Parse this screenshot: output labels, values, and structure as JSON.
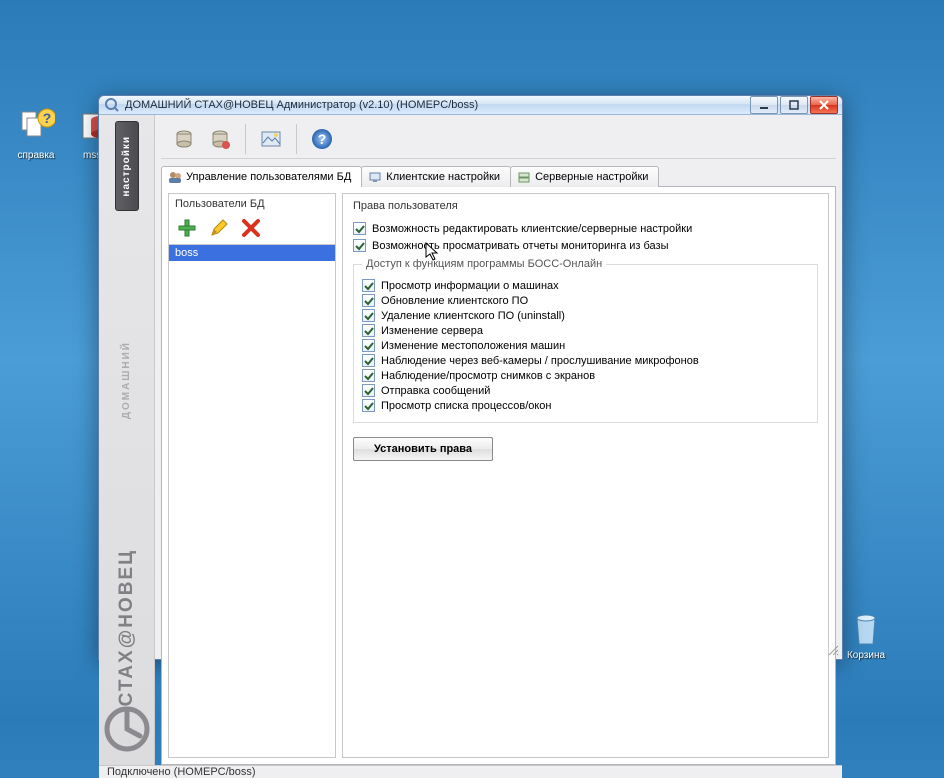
{
  "desktop": {
    "help_label": "справка",
    "mssql_label": "mssql",
    "recycle_label": "Корзина"
  },
  "window": {
    "title": "ДОМАШНИЙ СТАХ@НОВЕЦ Администратор (v2.10)  (HOMEPC/boss)"
  },
  "brand": {
    "vert1": "ДОМАШНИЙ",
    "vert2": "СТАХ@НОВЕЦ"
  },
  "sidebar_tab": "настройки",
  "tabs": {
    "users": "Управление пользователями БД",
    "client": "Клиентские настройки",
    "server": "Серверные настройки"
  },
  "left": {
    "header": "Пользователи БД",
    "user": "boss"
  },
  "right": {
    "header": "Права пользователя",
    "chk_edit": "Возможность редактировать клиентские/серверные настройки",
    "chk_view": "Возможность просматривать отчеты мониторинга из базы",
    "fs_title": "Доступ к функциям программы БОСС-Онлайн",
    "opts": [
      "Просмотр информации о машинах",
      "Обновление клиентского ПО",
      "Удаление клиентского ПО (uninstall)",
      "Изменение сервера",
      "Изменение местоположения машин",
      "Наблюдение через веб-камеры / прослушивание микрофонов",
      "Наблюдение/просмотр снимков с экранов",
      "Отправка сообщений",
      "Просмотр списка процессов/окон"
    ],
    "button": "Установить права"
  },
  "status": "Подключено  (HOMEPC/boss)"
}
